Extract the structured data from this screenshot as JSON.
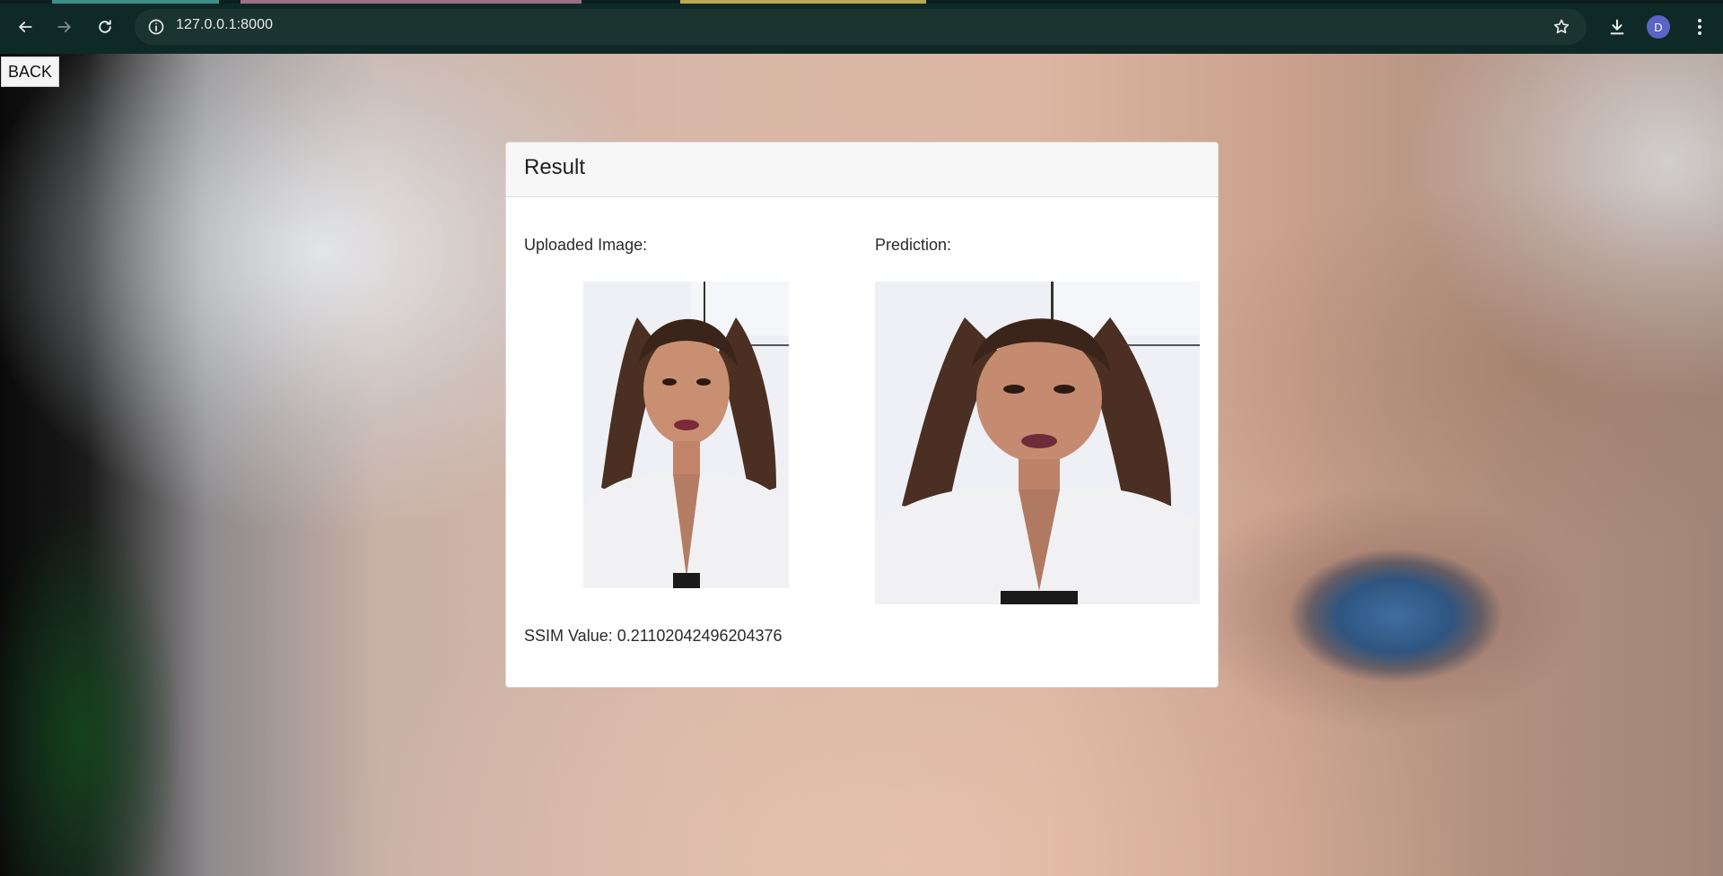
{
  "browser": {
    "url": "127.0.0.1:8000",
    "profile_initial": "D",
    "icons": {
      "back": "arrow-left-icon",
      "forward": "arrow-right-icon",
      "reload": "reload-icon",
      "site_info": "info-icon",
      "bookmark": "star-icon",
      "downloads": "download-icon",
      "menu": "kebab-menu-icon"
    }
  },
  "page": {
    "back_label": "BACK",
    "card": {
      "title": "Result",
      "uploaded_label": "Uploaded Image:",
      "prediction_label": "Prediction:",
      "ssim_text": "SSIM Value: 0.21102042496204376"
    }
  },
  "colors": {
    "chrome_bg": "#0f2a26",
    "omnibox_bg": "#1c3430",
    "avatar_bg": "#5a64c4",
    "card_header_bg": "#f7f7f7"
  }
}
